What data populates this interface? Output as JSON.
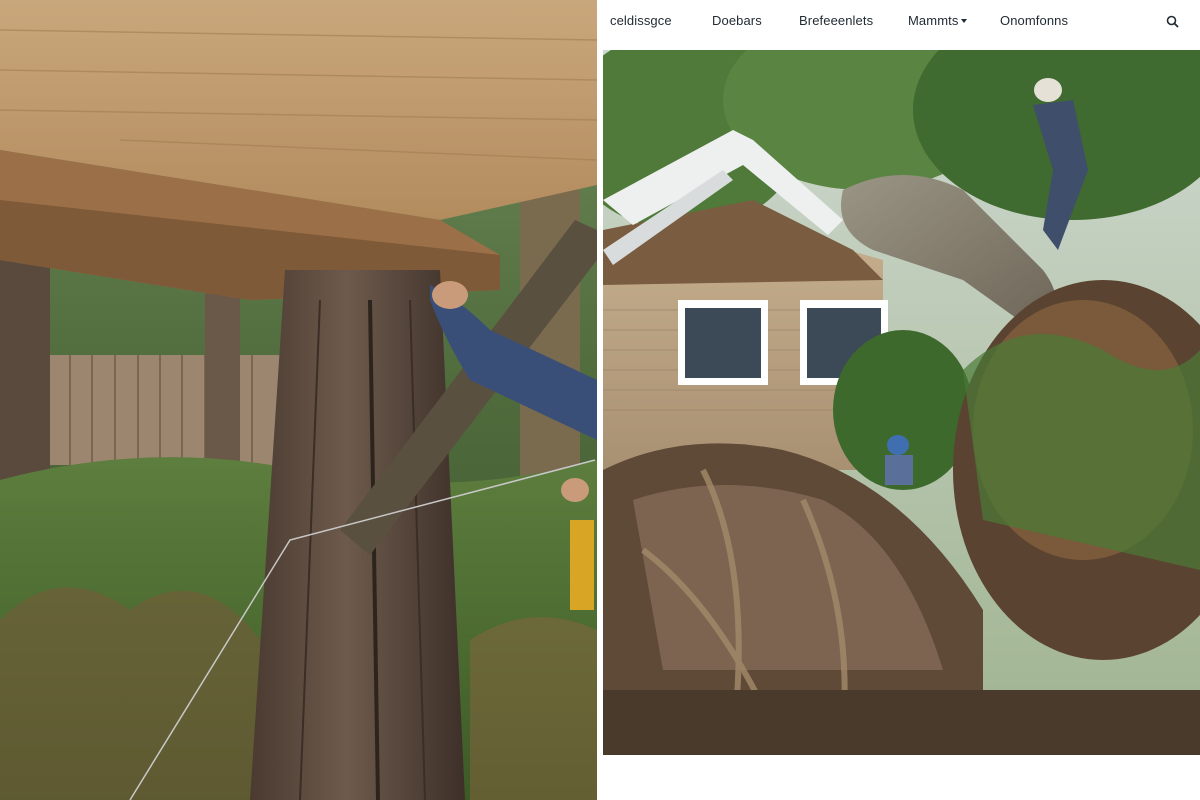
{
  "navbar": {
    "items": [
      {
        "label": "celdissgce"
      },
      {
        "label": "Doebars"
      },
      {
        "label": "Brefeeenlets"
      },
      {
        "label": "Mammts"
      },
      {
        "label": "Onomfonns"
      }
    ],
    "search_icon": "search-icon"
  },
  "images": {
    "left": "wooden deck post on tree trunk with worker hand and cables in fern forest",
    "right": "fallen uprooted tree on house roof with workers and crane"
  },
  "colors": {
    "nav_text": "#1f2a33",
    "background": "#ffffff"
  }
}
